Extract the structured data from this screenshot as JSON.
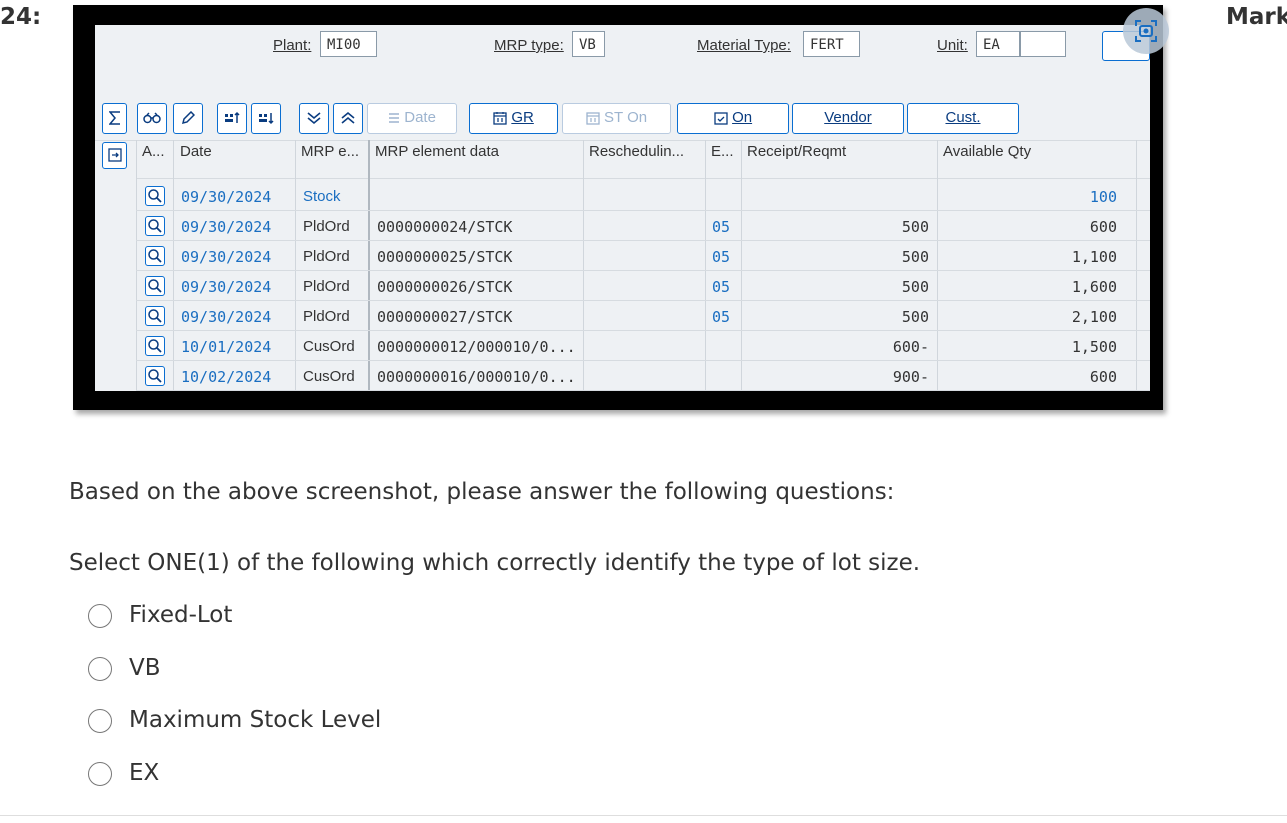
{
  "question": {
    "number_label": "24:",
    "marks_label": "Mark",
    "intro": "Based on the above screenshot, please answer the following questions:",
    "prompt": "Select ONE(1) of the following which correctly identify the type of lot size.",
    "options": [
      "Fixed-Lot",
      "VB",
      "Maximum Stock Level",
      "EX"
    ]
  },
  "sap_header": {
    "plant_label": "Plant:",
    "plant_value": "MI00",
    "mrp_type_label": "MRP type:",
    "mrp_type_value": "VB",
    "material_type_label": "Material Type:",
    "material_type_value": "FERT",
    "unit_label": "Unit:",
    "unit_value": "EA"
  },
  "toolbar": {
    "date_label": "Date",
    "gr_label": "GR",
    "st_on_label": "ST On",
    "on_label": "On",
    "vendor_label": "Vendor",
    "cust_label": "Cust."
  },
  "table": {
    "columns": [
      "A...",
      "Date",
      "MRP e...",
      "MRP element data",
      "Reschedulin...",
      "E...",
      "Receipt/Reqmt",
      "Available Qty"
    ],
    "rows": [
      {
        "date": "09/30/2024",
        "mrp_element": "Stock",
        "element_data": "",
        "exception": "",
        "receipt": "",
        "available": "100"
      },
      {
        "date": "09/30/2024",
        "mrp_element": "PldOrd",
        "element_data": "0000000024/STCK",
        "exception": "05",
        "receipt": "500",
        "available": "600"
      },
      {
        "date": "09/30/2024",
        "mrp_element": "PldOrd",
        "element_data": "0000000025/STCK",
        "exception": "05",
        "receipt": "500",
        "available": "1,100"
      },
      {
        "date": "09/30/2024",
        "mrp_element": "PldOrd",
        "element_data": "0000000026/STCK",
        "exception": "05",
        "receipt": "500",
        "available": "1,600"
      },
      {
        "date": "09/30/2024",
        "mrp_element": "PldOrd",
        "element_data": "0000000027/STCK",
        "exception": "05",
        "receipt": "500",
        "available": "2,100"
      },
      {
        "date": "10/01/2024",
        "mrp_element": "CusOrd",
        "element_data": "0000000012/000010/0...",
        "exception": "",
        "receipt": "600-",
        "available": "1,500"
      },
      {
        "date": "10/02/2024",
        "mrp_element": "CusOrd",
        "element_data": "0000000016/000010/0...",
        "exception": "",
        "receipt": "900-",
        "available": "600"
      }
    ]
  },
  "colors": {
    "accent": "#0a6ed1",
    "link_blue": "#1a6ec1"
  }
}
